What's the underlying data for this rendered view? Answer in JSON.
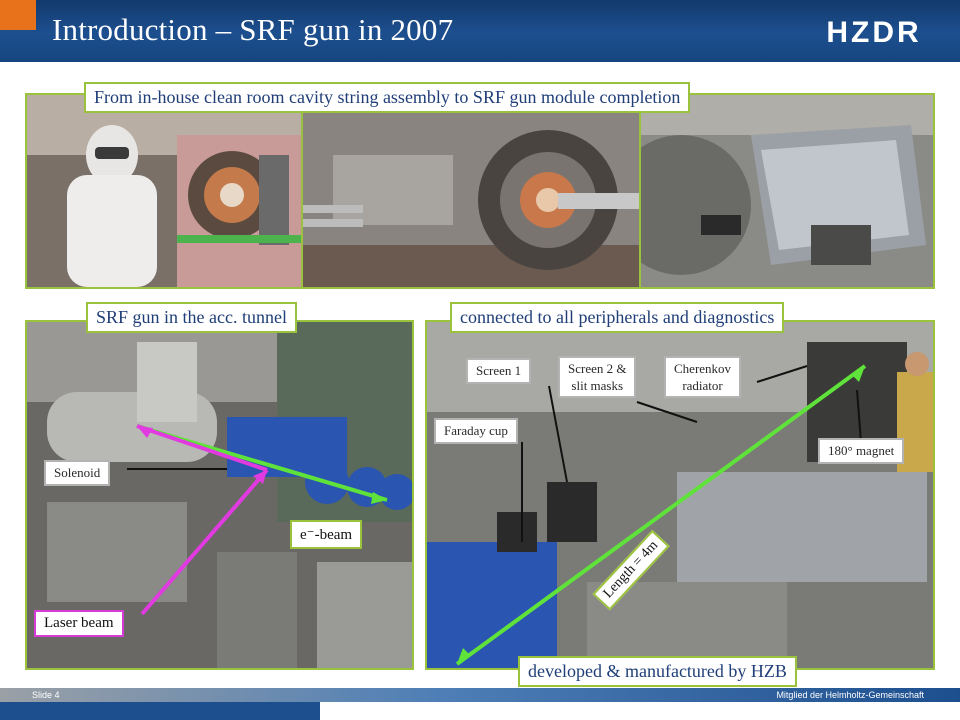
{
  "header": {
    "title": "Introduction – SRF gun in 2007",
    "logo_text": "HZDR"
  },
  "labels": {
    "top_caption": "From in-house clean room cavity string assembly to SRF gun module completion",
    "tunnel_caption": "SRF gun in the acc. tunnel",
    "peripherals_caption": "connected to all peripherals and diagnostics",
    "hzb_caption": "developed & manufactured by HZB",
    "solenoid": "Solenoid",
    "ebeam": "e⁻-beam",
    "laser_beam": "Laser beam",
    "screen1": "Screen 1",
    "screen2_line1": "Screen 2 &",
    "screen2_line2": "slit masks",
    "cherenkov_line1": "Cherenkov",
    "cherenkov_line2": "radiator",
    "faraday": "Faraday cup",
    "magnet": "180° magnet",
    "length": "Length = 4m"
  },
  "footer": {
    "slide": "Slide 4",
    "member": "Mitglied der Helmholtz-Gemeinschaft"
  },
  "colors": {
    "header_blue": "#1d4f8f",
    "accent_orange": "#e8711c",
    "frame_green": "#9bc23c",
    "beam_green": "#5fe33a",
    "laser_magenta": "#e13ae1",
    "caption_blue": "#1f3e78"
  }
}
